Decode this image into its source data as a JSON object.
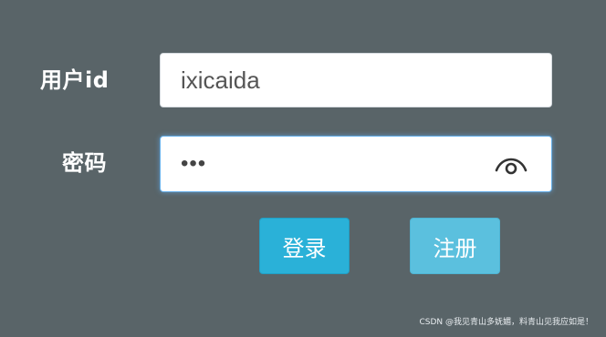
{
  "form": {
    "user_label": "用户id",
    "user_value": "ixicaida",
    "password_label": "密码",
    "password_value": "123",
    "login_label": "登录",
    "register_label": "注册",
    "password_toggle_icon": "eye-icon"
  },
  "watermark": "CSDN @我见青山多妩媚，料青山见我应如是！",
  "colors": {
    "background": "#596468",
    "login_button": "#2ab1d8",
    "register_button": "#5bc0de",
    "focus_border": "#66afe9"
  }
}
